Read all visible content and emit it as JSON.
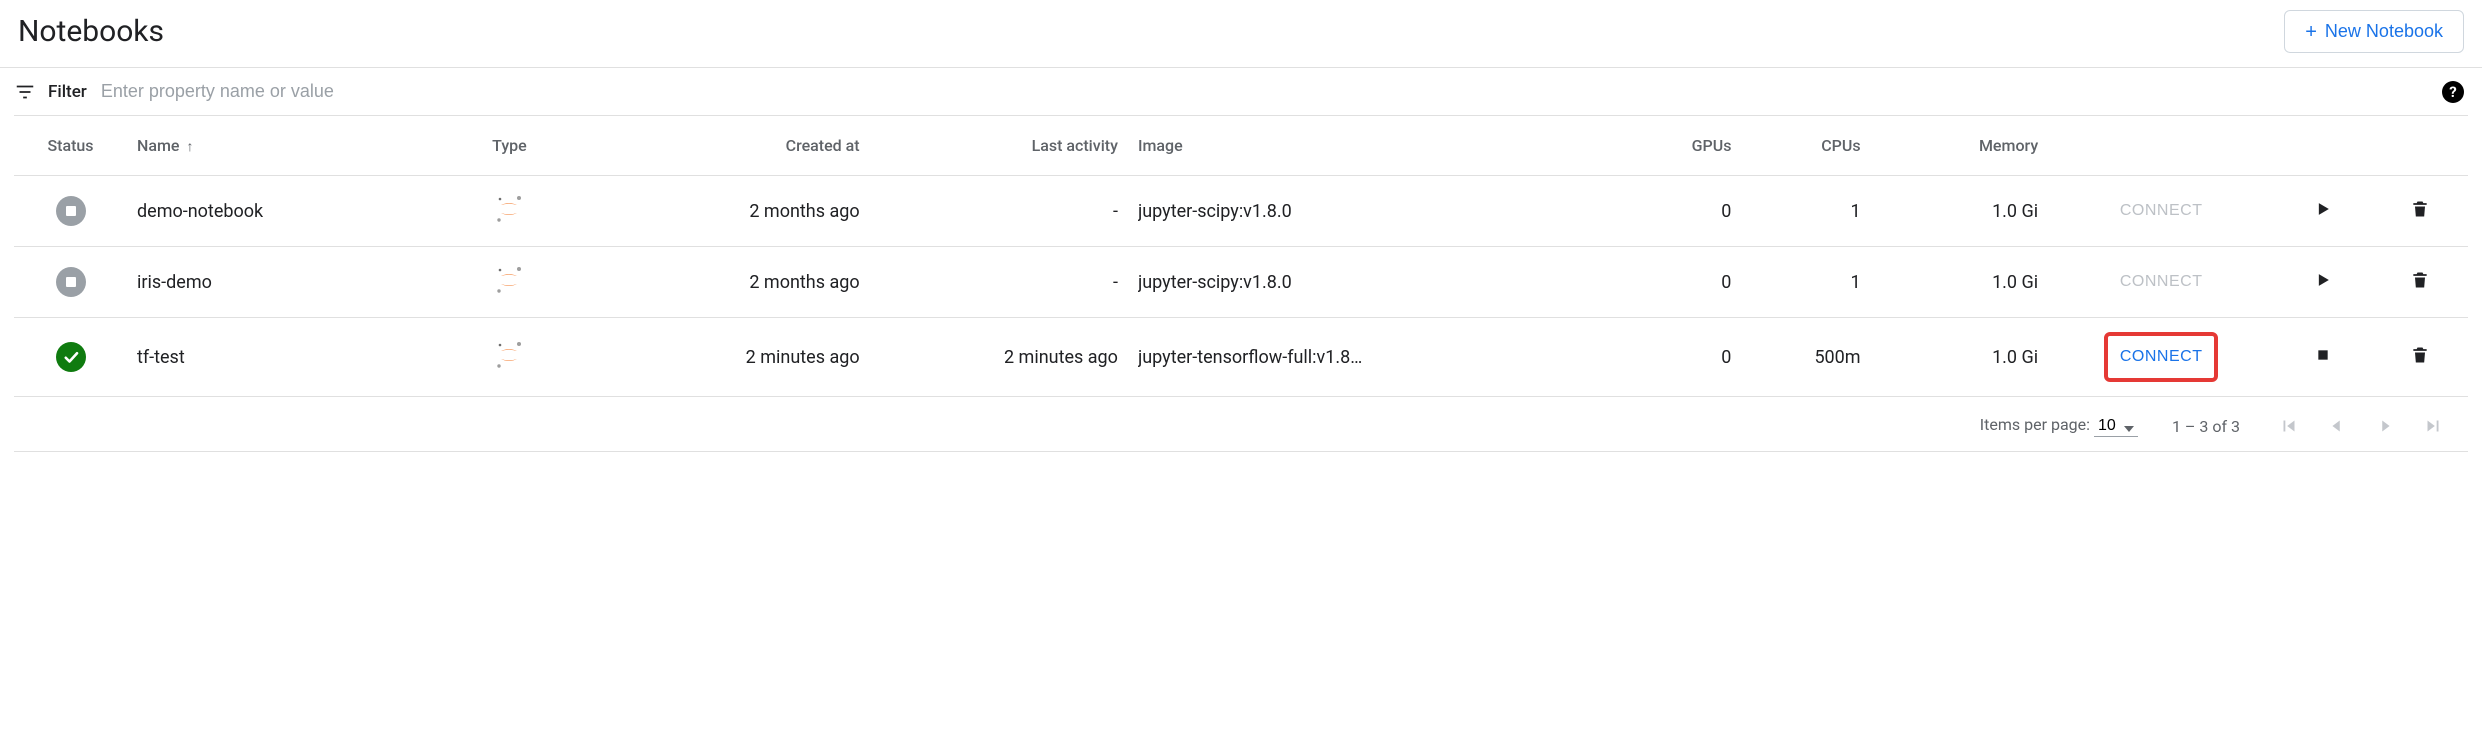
{
  "header": {
    "title": "Notebooks",
    "new_button": "New Notebook"
  },
  "filter": {
    "label": "Filter",
    "placeholder": "Enter property name or value"
  },
  "columns": {
    "status": "Status",
    "name": "Name",
    "type": "Type",
    "created": "Created at",
    "activity": "Last activity",
    "image": "Image",
    "gpus": "GPUs",
    "cpus": "CPUs",
    "memory": "Memory"
  },
  "rows": [
    {
      "status": "stopped",
      "name": "demo-notebook",
      "type_icon": "jupyter",
      "created": "2 months ago",
      "activity": "-",
      "image": "jupyter-scipy:v1.8.0",
      "gpus": "0",
      "cpus": "1",
      "memory": "1.0 Gi",
      "connect_enabled": false,
      "connect_label": "CONNECT",
      "action": "start"
    },
    {
      "status": "stopped",
      "name": "iris-demo",
      "type_icon": "jupyter",
      "created": "2 months ago",
      "activity": "-",
      "image": "jupyter-scipy:v1.8.0",
      "gpus": "0",
      "cpus": "1",
      "memory": "1.0 Gi",
      "connect_enabled": false,
      "connect_label": "CONNECT",
      "action": "start"
    },
    {
      "status": "running",
      "name": "tf-test",
      "type_icon": "jupyter",
      "created": "2 minutes ago",
      "activity": "2 minutes ago",
      "image": "jupyter-tensorflow-full:v1.8…",
      "gpus": "0",
      "cpus": "500m",
      "memory": "1.0 Gi",
      "connect_enabled": true,
      "connect_label": "CONNECT",
      "action": "stop",
      "highlight": true
    }
  ],
  "paginator": {
    "items_per_page_label": "Items per page:",
    "items_per_page_value": "10",
    "range": "1 – 3 of 3"
  }
}
